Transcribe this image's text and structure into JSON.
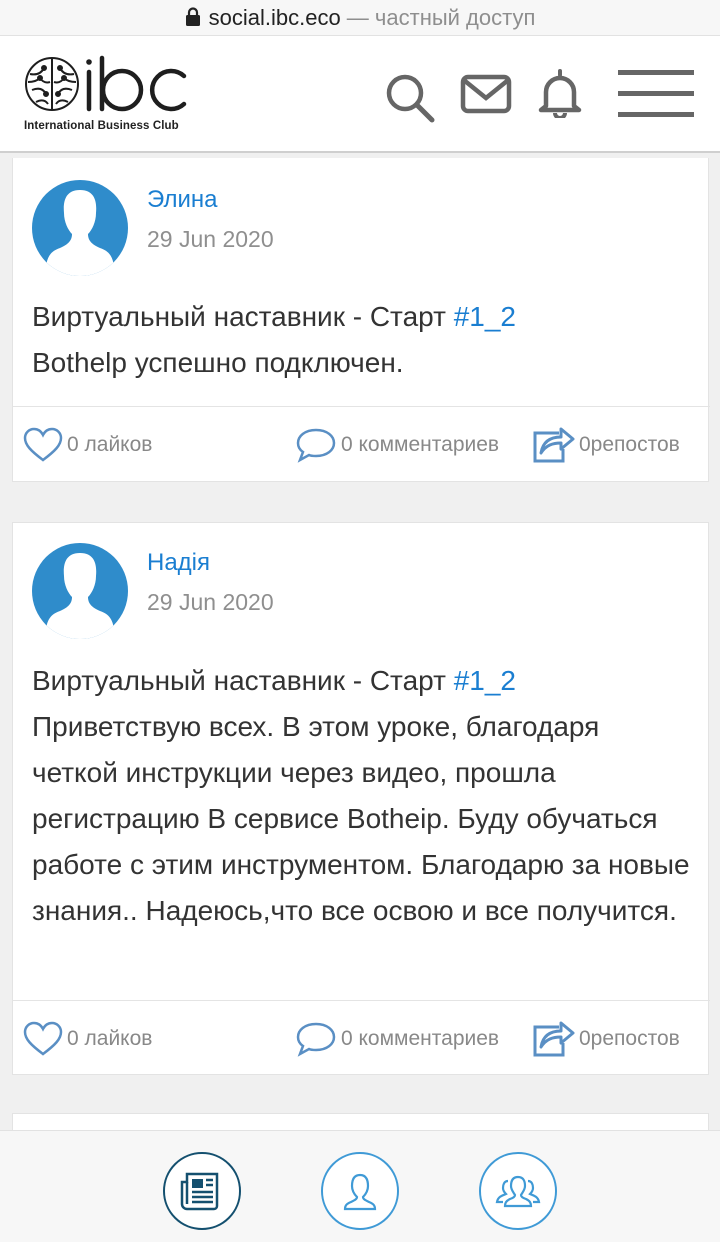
{
  "browser": {
    "domain": "social.ibc.eco",
    "separator": " — ",
    "mode": "частный доступ"
  },
  "header": {
    "logo_caption": "International Business Club",
    "icons": [
      "search-icon",
      "mail-icon",
      "bell-icon",
      "menu-icon"
    ]
  },
  "colors": {
    "accent": "#1a7ed1",
    "avatar": "#2f8ccb",
    "muted": "#888888"
  },
  "posts": [
    {
      "author": "Элина",
      "date": "29 Jun 2020",
      "text_prefix": "Виртуальный наставник - Старт ",
      "tag": "#1_2",
      "text_body": "Bothelp успешно подключен.",
      "likes": "0 лайков",
      "comments": "0 комментариев",
      "reposts": "0репостов"
    },
    {
      "author": "Надія",
      "date": "29 Jun 2020",
      "text_prefix": "Виртуальный наставник - Старт ",
      "tag": "#1_2",
      "text_body": "Приветствую всех. В этом уроке, благодаря четкой инструкции через видео, прошла регистрацию В сервисе Botheip. Буду обучаться работе с этим инструментом. Благодарю за новые знания.. Надеюсь,что все освою и все получится.",
      "likes": "0 лайков",
      "comments": "0 комментариев",
      "reposts": "0репостов"
    }
  ],
  "bottom_nav": {
    "items": [
      "news-icon",
      "profile-icon",
      "groups-icon"
    ],
    "active": "news-icon"
  }
}
